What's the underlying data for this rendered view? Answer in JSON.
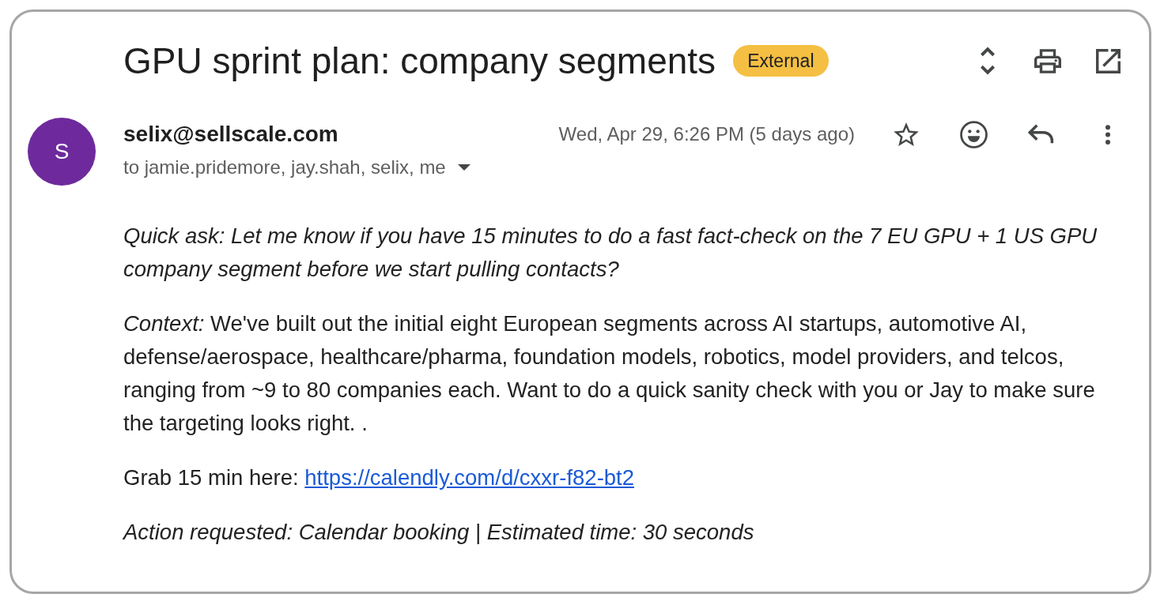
{
  "thread": {
    "subject": "GPU sprint plan: company segments",
    "label": "External"
  },
  "message": {
    "avatar": "S",
    "sender": "selix@sellscale.com",
    "recipients": "to jamie.pridemore, jay.shah, selix, me",
    "date": "Wed, Apr 29, 6:26 PM (5 days ago)",
    "starred": false
  },
  "body": [
    {
      "kind": "italic",
      "text": "Quick ask: Let me know if you have 15 minutes to do a fast fact-check on the 7 EU GPU + 1 US GPU company segment before we start pulling contacts?"
    },
    {
      "kind": "plain",
      "text": "*Context:* We've built out the initial eight European segments across AI startups, automotive AI, defense/aerospace, healthcare/pharma, foundation models, robotics, model providers, and telcos, ranging from ~9 to 80 companies each. Want to do a quick sanity check with you or Jay to make sure the targeting looks right. ."
    },
    {
      "kind": "link",
      "text": "Grab 15 min here:",
      "link": "https://calendly.com/d/cxxr-f82-bt2"
    },
    {
      "kind": "italic",
      "text": "Action requested: Calendar booking | Estimated time: 30 seconds"
    }
  ]
}
